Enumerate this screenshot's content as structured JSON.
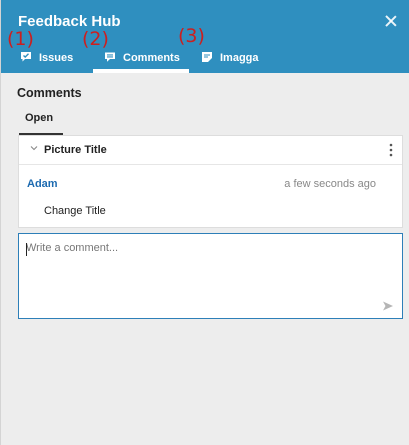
{
  "header": {
    "title": "Feedback Hub",
    "tabs": [
      {
        "label": "Issues",
        "icon": "issues-icon"
      },
      {
        "label": "Comments",
        "icon": "comment-icon",
        "active": true
      },
      {
        "label": "Imagga",
        "icon": "imagga-icon"
      }
    ]
  },
  "annotations": [
    "(1)",
    "(2)",
    "(3)"
  ],
  "comments": {
    "section_title": "Comments",
    "subtab_open": "Open",
    "thread": {
      "title": "Picture Title",
      "author": "Adam",
      "timestamp": "a few seconds ago",
      "text": "Change Title"
    },
    "input_placeholder": "Write a comment..."
  },
  "colors": {
    "header": "#2f8fbf",
    "author": "#1c6ab0",
    "annotation": "#cc1f1f",
    "input_border": "#2d7fb8"
  }
}
